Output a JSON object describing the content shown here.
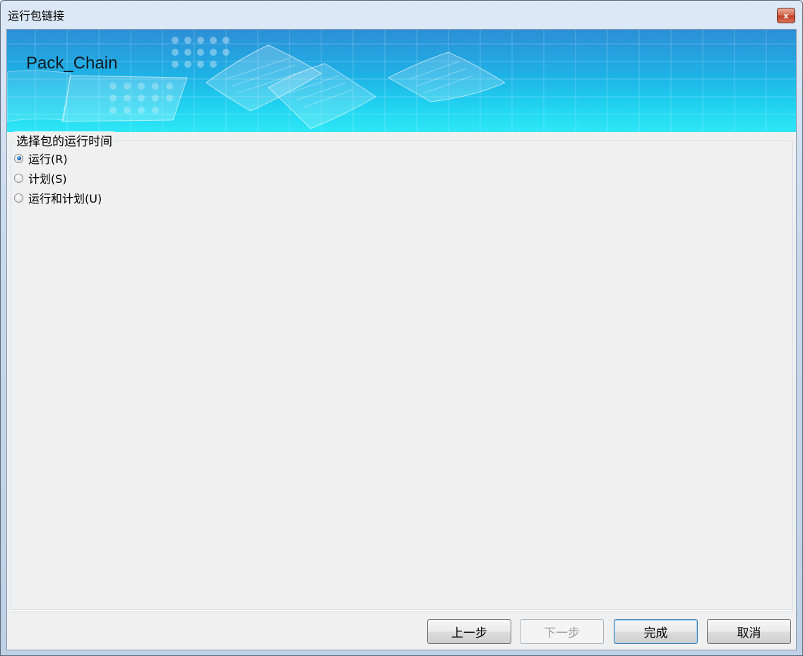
{
  "window": {
    "title": "运行包链接",
    "close_glyph": "x"
  },
  "banner": {
    "title": "Pack_Chain"
  },
  "group": {
    "legend": "选择包的运行时间",
    "options": [
      {
        "label": "运行(R)",
        "checked": true
      },
      {
        "label": "计划(S)",
        "checked": false
      },
      {
        "label": "运行和计划(U)",
        "checked": false
      }
    ]
  },
  "buttons": {
    "back": "上一步",
    "next": "下一步",
    "finish": "完成",
    "cancel": "取消"
  },
  "colors": {
    "banner_top": "#2d8fd6",
    "banner_bottom": "#2fe7f6",
    "client_bg": "#f0f0f0",
    "radio_dot": "#1b5fa8"
  },
  "icons": [
    "close-icon",
    "radio-checked-icon",
    "radio-unchecked-icon"
  ]
}
